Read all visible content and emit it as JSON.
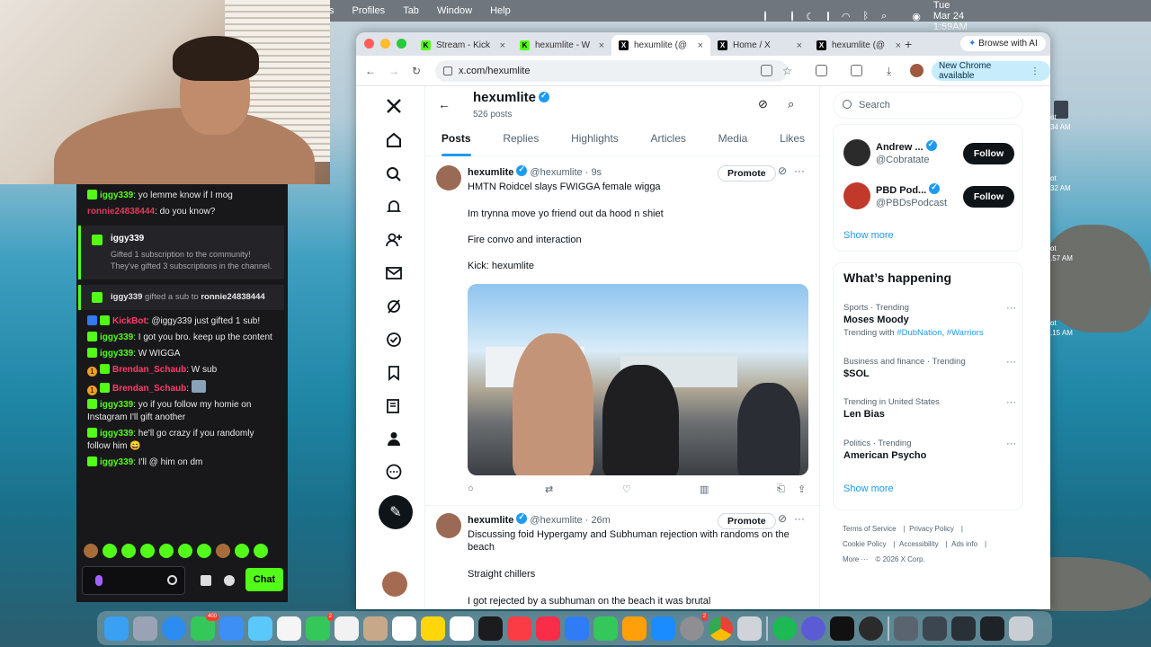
{
  "menubar": {
    "items": [
      "s",
      "Profiles",
      "Tab",
      "Window",
      "Help"
    ],
    "clock": "Tue Mar 24  1:59AM"
  },
  "chat": {
    "messages_top": [
      {
        "user": "iggy339",
        "user_color": "#53fc18",
        "text": ": yo lemme know if I mog"
      },
      {
        "user": "ronnie24838444",
        "user_color": "#e03a5c",
        "text": ": do you know?"
      }
    ],
    "sub_card": {
      "user": "iggy339",
      "line1": "Gifted 1 subscription to the community!",
      "line2": "They've gifted 3 subscriptions in the channel."
    },
    "gift_line": {
      "user": "iggy339",
      "mid": " gifted a sub to ",
      "target": "ronnie24838444"
    },
    "messages": [
      {
        "user": "KickBot",
        "user_color": "#ff3c6a",
        "text": ": @iggy339 just gifted 1 sub!"
      },
      {
        "user": "iggy339",
        "user_color": "#53fc18",
        "text": ": I got you bro. keep up the content"
      },
      {
        "user": "iggy339",
        "user_color": "#53fc18",
        "text": ": W WIGGA"
      },
      {
        "user": "Brendan_Schaub",
        "user_color": "#ff3c6a",
        "text": ": W sub"
      },
      {
        "user": "Brendan_Schaub",
        "user_color": "#ff3c6a",
        "text": ":"
      },
      {
        "user": "iggy339",
        "user_color": "#53fc18",
        "text": ": yo if you follow my homie on Instagram I'll gift another"
      },
      {
        "user": "iggy339",
        "user_color": "#53fc18",
        "text": ": he'll go crazy if you randomly follow him 😄"
      },
      {
        "user": "iggy339",
        "user_color": "#53fc18",
        "text": ": I'll @ him on dm"
      }
    ],
    "chat_button": "Chat"
  },
  "browser": {
    "tabs": [
      {
        "title": "Stream - Kick",
        "favicon": "kick"
      },
      {
        "title": "hexumlite - W",
        "favicon": "kick"
      },
      {
        "title": "hexumlite (@",
        "favicon": "x",
        "active": true
      },
      {
        "title": "Home / X",
        "favicon": "x"
      },
      {
        "title": "hexumlite (@",
        "favicon": "x"
      }
    ],
    "ai_button": "Browse with AI",
    "url": "x.com/hexumlite",
    "chrome_notice": "New Chrome available"
  },
  "profile": {
    "name": "hexumlite",
    "posts_count": "526 posts",
    "tabs": [
      "Posts",
      "Replies",
      "Highlights",
      "Articles",
      "Media",
      "Likes"
    ]
  },
  "tweets": [
    {
      "name": "hexumlite",
      "meta": "@hexumlite · 9s",
      "promote": "Promote",
      "lines": [
        "HMTN Roidcel slays FWIGGA female wigga",
        "Im trynna move yo friend out da hood n shiet",
        "Fire convo and interaction",
        "Kick: hexumlite"
      ]
    },
    {
      "name": "hexumlite",
      "meta": "@hexumlite · 26m",
      "promote": "Promote",
      "lines": [
        "Discussing foid Hypergamy and Subhuman rejection with randoms on the beach",
        "Straight chillers",
        "I got rejected by a subhuman on the beach it was brutal"
      ]
    }
  ],
  "right": {
    "search_placeholder": "Search",
    "who_to_follow": [
      {
        "name": "Andrew ...",
        "handle": "@Cobratate",
        "follow": "Follow",
        "color": "#2b2b2b"
      },
      {
        "name": "PBD Pod...",
        "handle": "@PBDsPodcast",
        "follow": "Follow",
        "color": "#c0392b"
      }
    ],
    "show_more": "Show more",
    "happening_title": "What’s happening",
    "trends": [
      {
        "category": "Sports · Trending",
        "title": "Moses Moody",
        "with_prefix": "Trending with ",
        "tag1": "#DubNation",
        "tag2": "#Warriors"
      },
      {
        "category": "Business and finance · Trending",
        "title": "$SOL"
      },
      {
        "category": "Trending in United States",
        "title": "Len Bias"
      },
      {
        "category": "Politics · Trending",
        "title": "American Psycho"
      }
    ],
    "show_more_2": "Show more",
    "footer": [
      "Terms of Service",
      "Privacy Policy",
      "Cookie Policy",
      "Accessibility",
      "Ads info",
      "More ···",
      "© 2026 X Corp."
    ]
  },
  "desktop_labels": [
    "ot",
    "34 AM",
    "ot",
    "32 AM",
    "ot",
    ".57 AM",
    "ot",
    ".15 AM"
  ],
  "dock_badges": {
    "messages": "400",
    "news": "2",
    "system": "2"
  }
}
